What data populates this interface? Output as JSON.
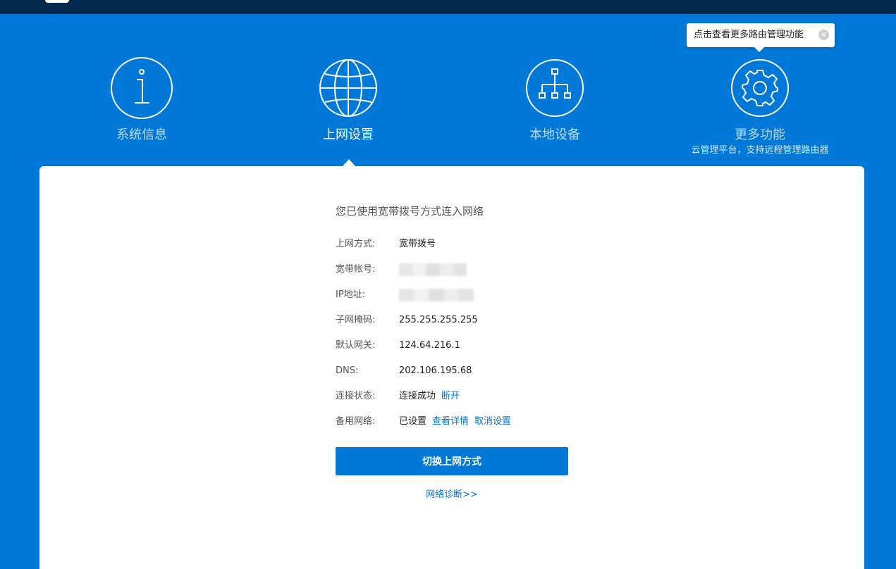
{
  "nav": {
    "items": [
      {
        "label": "系统信息",
        "icon": "info-icon"
      },
      {
        "label": "上网设置",
        "icon": "globe-icon",
        "active": true
      },
      {
        "label": "本地设备",
        "icon": "network-topology-icon"
      },
      {
        "label": "更多功能",
        "icon": "gear-icon",
        "subtitle": "云管理平台，支持远程管理路由器"
      }
    ]
  },
  "tooltip": {
    "text": "点击查看更多路由管理功能",
    "close_icon": "close-circle-icon"
  },
  "status": {
    "title": "您已使用宽带拨号方式连入网络",
    "rows": [
      {
        "label": "上网方式:",
        "value": "宽带拨号"
      },
      {
        "label": "宽带帐号:",
        "value": ""
      },
      {
        "label": "IP地址:",
        "value": ""
      },
      {
        "label": "子网掩码:",
        "value": "255.255.255.255"
      },
      {
        "label": "默认网关:",
        "value": "124.64.216.1"
      },
      {
        "label": "DNS:",
        "value": "202.106.195.68"
      },
      {
        "label": "连接状态:",
        "value": "连接成功",
        "link": "断开"
      },
      {
        "label": "备用网络:",
        "value": "已设置",
        "link": "查看详情",
        "link2": "取消设置"
      }
    ]
  },
  "actions": {
    "switch_button": "切换上网方式",
    "diagnose_link": "网络诊断>>"
  },
  "colors": {
    "brand": "#0078d7",
    "topbar": "#00294d",
    "panel": "#ffffff"
  }
}
